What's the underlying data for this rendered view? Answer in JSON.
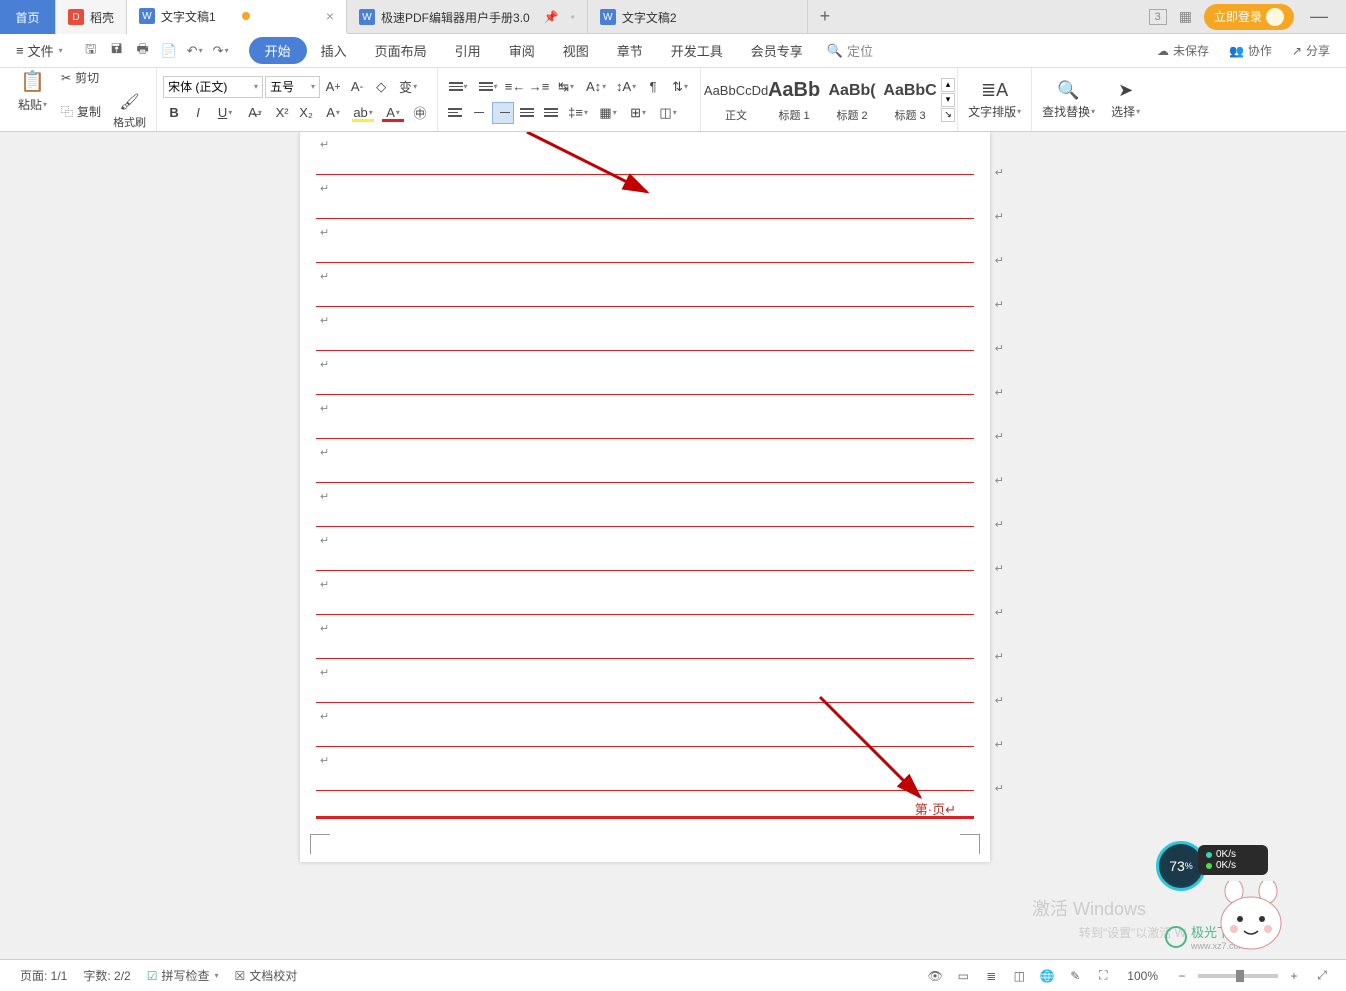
{
  "tabs": {
    "home": "首页",
    "docer": "稻壳",
    "doc1": "文字文稿1",
    "pdf": "极速PDF编辑器用户手册3.0",
    "doc2": "文字文稿2"
  },
  "topbar": {
    "page_num_indicator": "3",
    "login": "立即登录"
  },
  "menu": {
    "file": "文件",
    "tabs": [
      "开始",
      "插入",
      "页面布局",
      "引用",
      "审阅",
      "视图",
      "章节",
      "开发工具",
      "会员专享"
    ],
    "goto": "定位",
    "unsaved": "未保存",
    "coop": "协作",
    "share": "分享"
  },
  "ribbon": {
    "paste": "粘贴",
    "cut": "剪切",
    "copy": "复制",
    "format_painter": "格式刷",
    "font_name": "宋体 (正文)",
    "font_size": "五号",
    "styles": [
      {
        "preview": "AaBbCcDd",
        "name": "正文"
      },
      {
        "preview": "AaBb",
        "name": "标题 1"
      },
      {
        "preview": "AaBb(",
        "name": "标题 2"
      },
      {
        "preview": "AaBbC",
        "name": "标题 3"
      }
    ],
    "layout": "文字排版",
    "find_replace": "查找替换",
    "select": "选择"
  },
  "doc": {
    "page_number_text": "第·页"
  },
  "status": {
    "page": "页面: 1/1",
    "words": "字数: 2/2",
    "spell": "拼写检查",
    "proof": "文档校对",
    "zoom": "100%"
  },
  "floaty": {
    "gauge": "73",
    "gauge_unit": "%",
    "up": "0K/s",
    "down": "0K/s"
  },
  "watermark": {
    "l1": "激活 Windows",
    "l2": "转到\"设置\"以激活 W",
    "logo": "极光下载",
    "logo_sub": "www.xz7.com"
  }
}
